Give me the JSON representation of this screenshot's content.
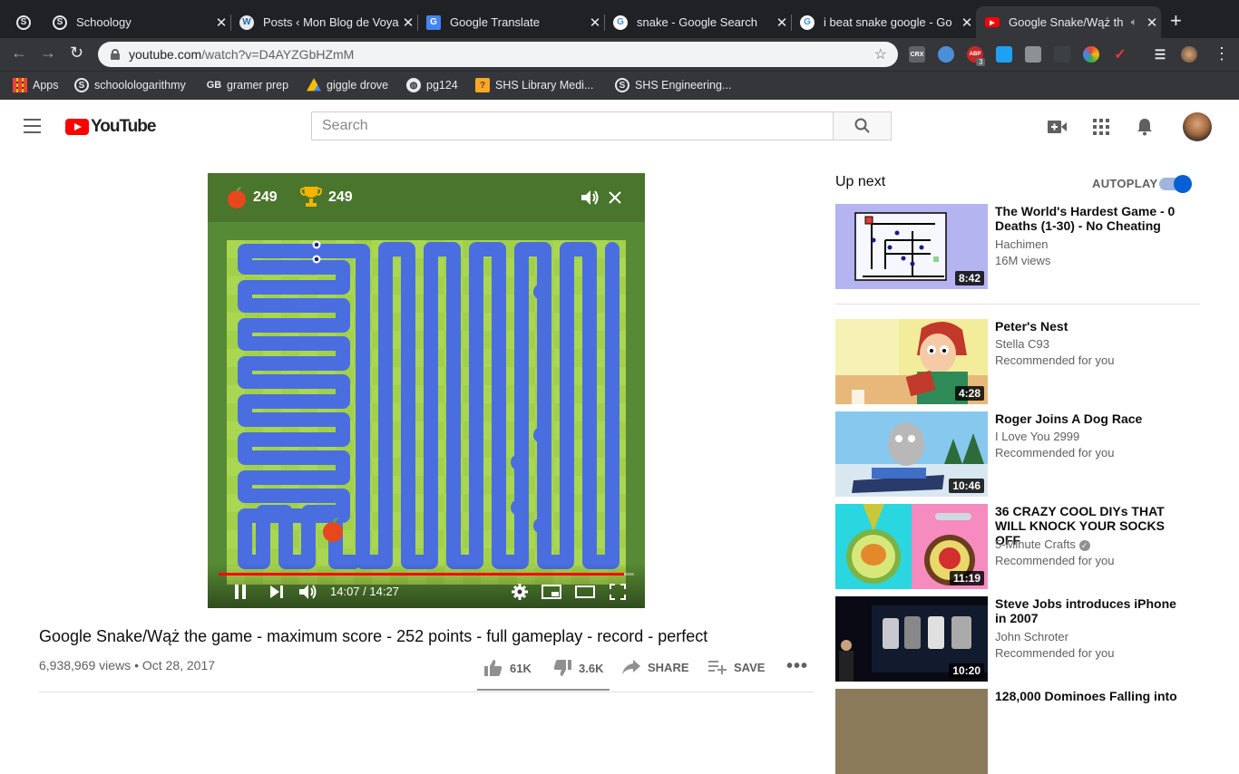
{
  "browser": {
    "tabs": [
      {
        "title": "",
        "icon": "schoology-icon"
      },
      {
        "title": "Schoology",
        "icon": "schoology-icon"
      },
      {
        "title": "Posts ‹ Mon Blog de Voya",
        "icon": "wordpress-icon"
      },
      {
        "title": "Google Translate",
        "icon": "google-translate-icon"
      },
      {
        "title": "snake - Google Search",
        "icon": "google-icon"
      },
      {
        "title": "i beat snake google - Go",
        "icon": "google-icon"
      },
      {
        "title": "Google Snake/Wąż th",
        "icon": "youtube-icon",
        "active": true
      }
    ],
    "url_host": "youtube.com",
    "url_rest": "/watch?v=D4AYZGbHZmM",
    "bookmarks": [
      {
        "label": "Apps",
        "icon": "apps-grid-icon"
      },
      {
        "label": "schoolologarithmy",
        "icon": "schoology-icon"
      },
      {
        "label": "gramer prep",
        "icon": "gb-icon"
      },
      {
        "label": "giggle drove",
        "icon": "google-drive-icon"
      },
      {
        "label": "pg124",
        "icon": "globe-icon"
      },
      {
        "label": "SHS Library Medi...",
        "icon": "library-icon"
      },
      {
        "label": "SHS Engineering...",
        "icon": "schoology-icon"
      }
    ],
    "extension_labels": {
      "crx": "CRX",
      "abp": "ABP",
      "abp_count": "3"
    }
  },
  "youtube": {
    "logo_text": "YouTube",
    "search_placeholder": "Search"
  },
  "player": {
    "apple_score": "249",
    "trophy_score": "249",
    "time": "14:07 / 14:27",
    "progress_fraction": 0.976
  },
  "video": {
    "title": "Google Snake/Wąż the game - maximum score - 252 points - full gameplay - record - perfect",
    "views_date": "6,938,969 views • Oct 28, 2017",
    "likes": "61K",
    "dislikes": "3.6K",
    "share": "SHARE",
    "save": "SAVE"
  },
  "sidebar": {
    "up_next": "Up next",
    "autoplay": "AUTOPLAY",
    "items": [
      {
        "title": "The World's Hardest Game - 0 Deaths (1-30) - No Cheating",
        "channel": "Hachimen",
        "meta": "16M views",
        "duration": "8:42"
      },
      {
        "title": "Peter's Nest",
        "channel": "Stella C93",
        "meta": "Recommended for you",
        "duration": "4:28"
      },
      {
        "title": "Roger Joins A Dog Race",
        "channel": "I Love You 2999",
        "meta": "Recommended for you",
        "duration": "10:46"
      },
      {
        "title": "36 CRAZY COOL DIYs THAT WILL KNOCK YOUR SOCKS OFF",
        "channel": "5-Minute Crafts",
        "meta": "Recommended for you",
        "duration": "11:19"
      },
      {
        "title": "Steve Jobs introduces iPhone in 2007",
        "channel": "John Schroter",
        "meta": "Recommended for you",
        "duration": "10:20"
      },
      {
        "title": "128,000 Dominoes Falling into"
      }
    ]
  }
}
